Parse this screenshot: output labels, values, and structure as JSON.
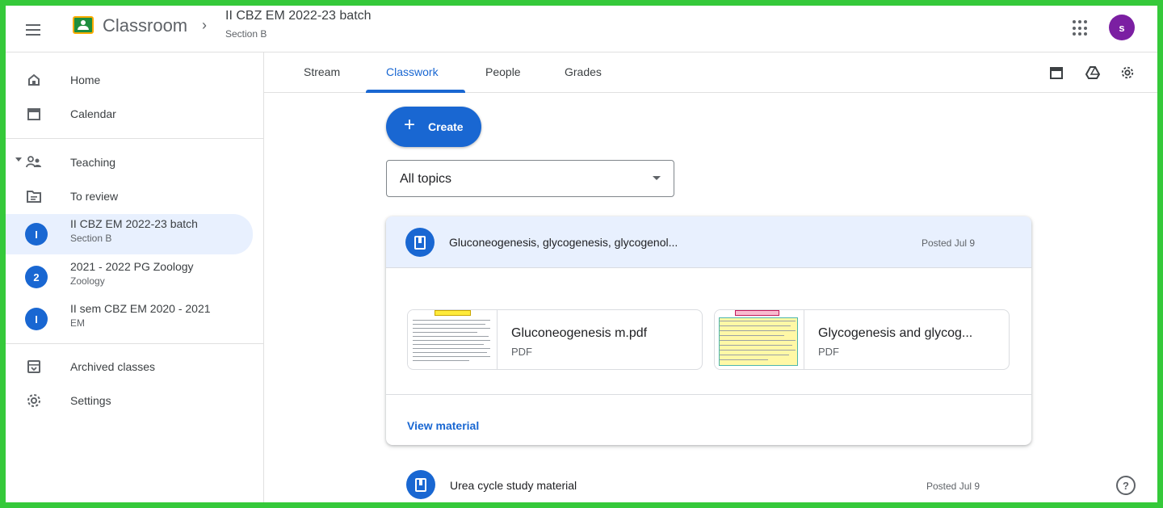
{
  "header": {
    "app_title": "Classroom",
    "course_title": "II CBZ EM 2022-23 batch",
    "course_section": "Section B",
    "avatar_initial": "s"
  },
  "sidebar": {
    "home": "Home",
    "calendar": "Calendar",
    "teaching": "Teaching",
    "to_review": "To review",
    "classes": [
      {
        "initial": "I",
        "name": "II CBZ EM 2022-23 batch",
        "sub": "Section B"
      },
      {
        "initial": "2",
        "name": "2021 - 2022 PG Zoology",
        "sub": "Zoology"
      },
      {
        "initial": "I",
        "name": "II sem CBZ EM 2020 - 2021",
        "sub": "EM"
      }
    ],
    "archived": "Archived classes",
    "settings": "Settings"
  },
  "tabs": {
    "stream": "Stream",
    "classwork": "Classwork",
    "people": "People",
    "grades": "Grades"
  },
  "main": {
    "create_label": "Create",
    "topic_filter": "All topics",
    "material": {
      "title": "Gluconeogenesis, glycogenesis, glycogenol...",
      "posted": "Posted Jul 9",
      "attachments": [
        {
          "name": "Gluconeogenesis m.pdf",
          "type": "PDF"
        },
        {
          "name": "Glycogenesis and glycog...",
          "type": "PDF"
        }
      ],
      "view_label": "View material"
    },
    "material2": {
      "title": "Urea cycle study material",
      "posted": "Posted Jul 9"
    }
  },
  "colors": {
    "accent": "#1967d2",
    "frame": "#35c93a",
    "avatar": "#7b1fa2"
  }
}
